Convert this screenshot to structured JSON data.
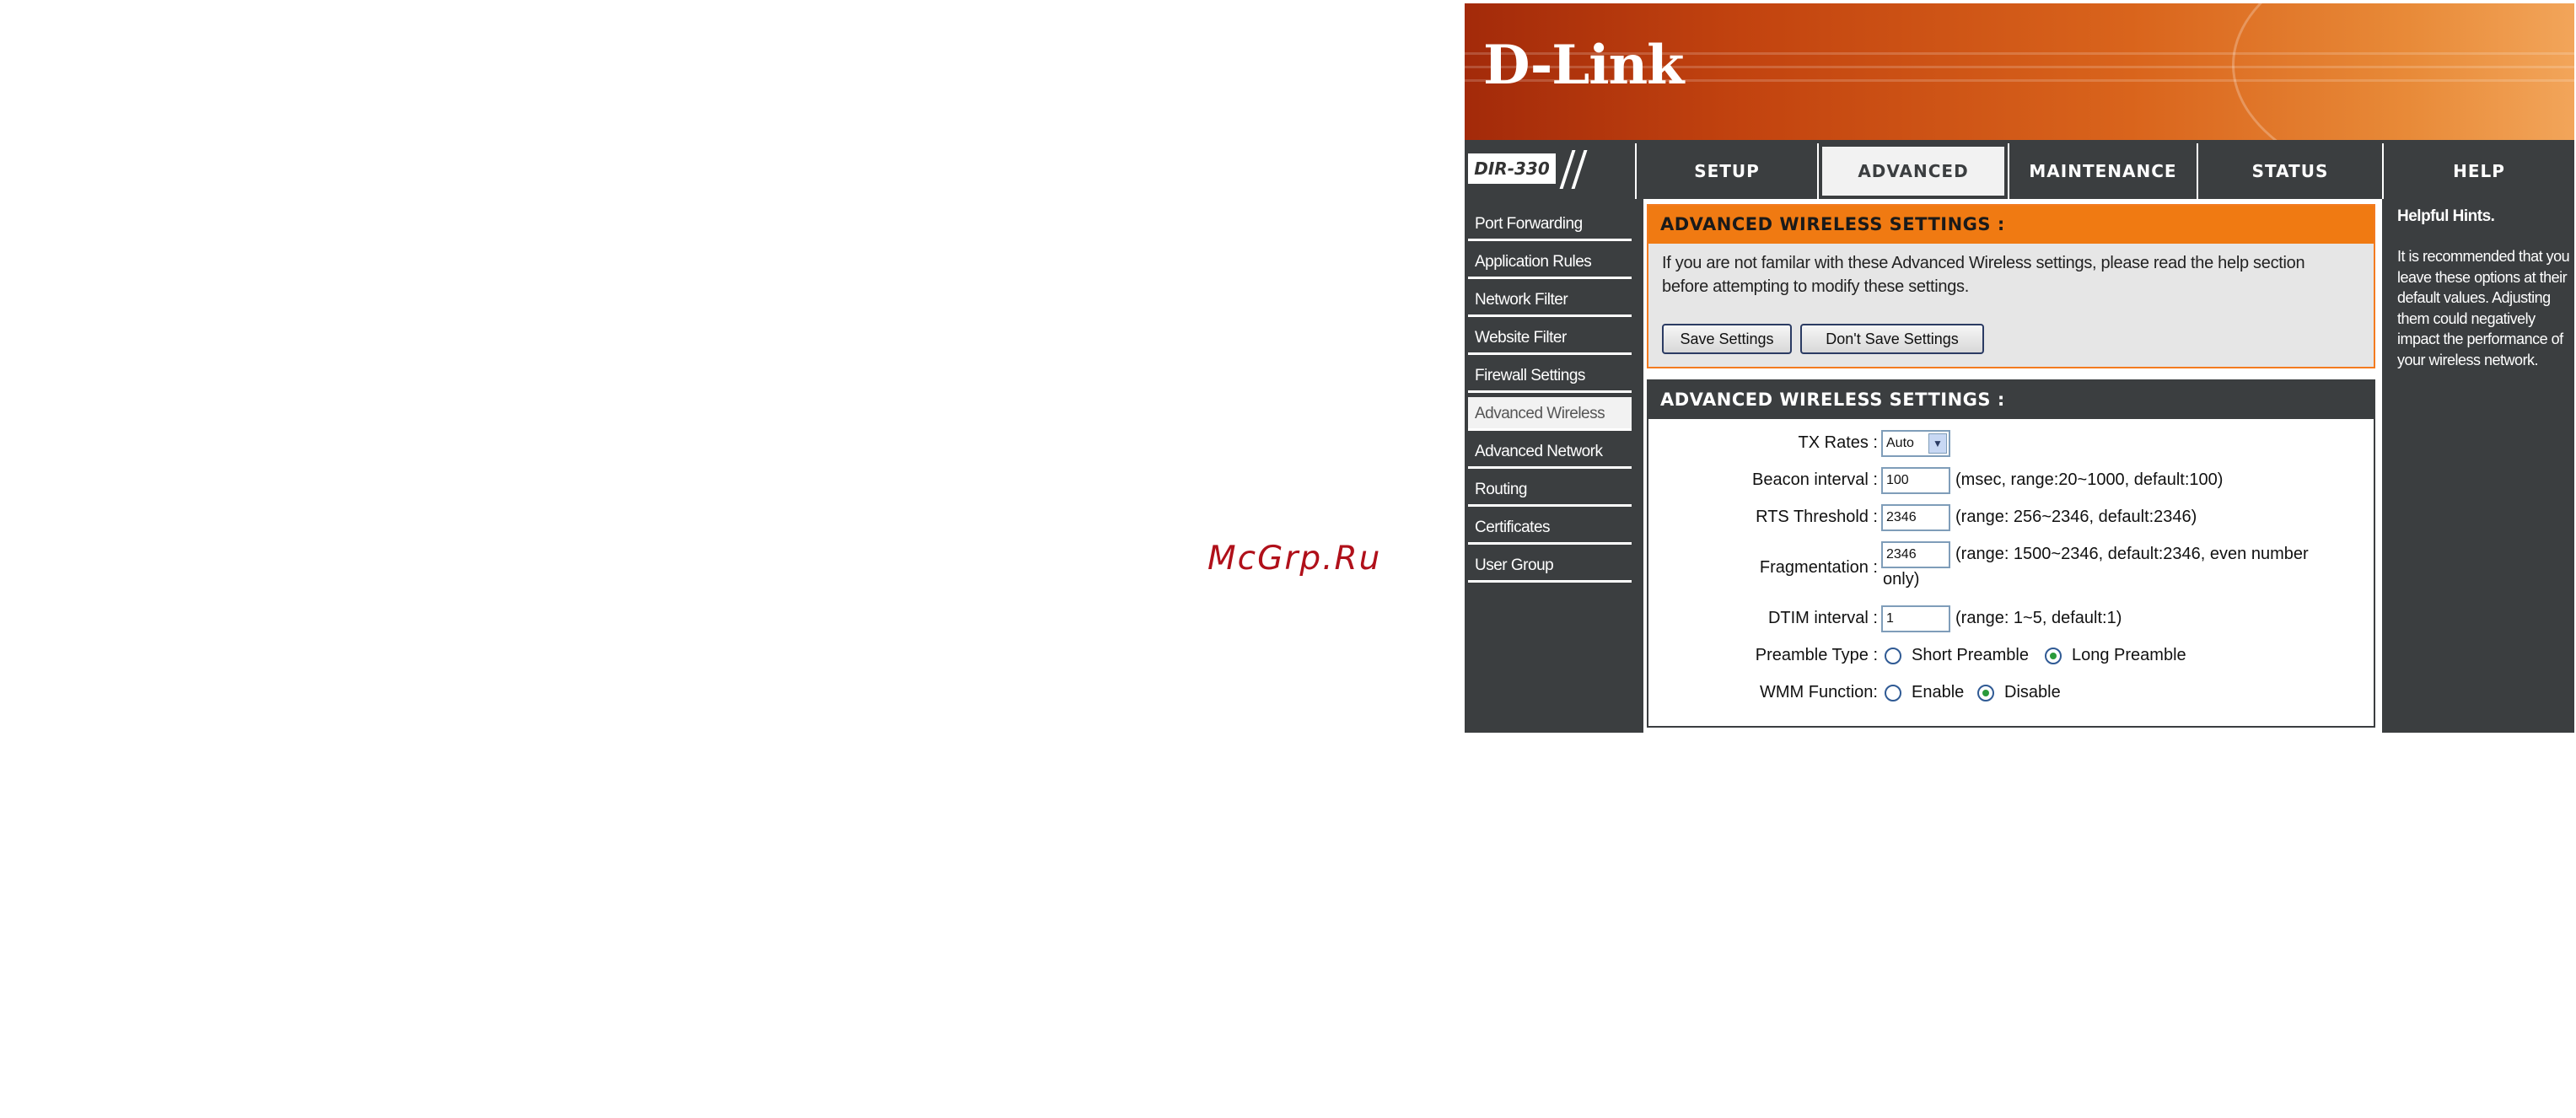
{
  "watermark": "McGrp.Ru",
  "brand": {
    "logo": "D-Link",
    "model": "DIR-330"
  },
  "tabs": [
    {
      "label": "SETUP"
    },
    {
      "label": "ADVANCED"
    },
    {
      "label": "MAINTENANCE"
    },
    {
      "label": "STATUS"
    },
    {
      "label": "HELP"
    }
  ],
  "active_tab": "ADVANCED",
  "sidebar": {
    "items": [
      {
        "label": "Port Forwarding"
      },
      {
        "label": "Application Rules"
      },
      {
        "label": "Network Filter"
      },
      {
        "label": "Website Filter"
      },
      {
        "label": "Firewall Settings"
      },
      {
        "label": "Advanced Wireless"
      },
      {
        "label": "Advanced Network"
      },
      {
        "label": "Routing"
      },
      {
        "label": "Certificates"
      },
      {
        "label": "User Group"
      }
    ],
    "active": "Advanced Wireless"
  },
  "intro": {
    "title": "ADVANCED WIRELESS SETTINGS :",
    "text_line1": "If you are not familar with these Advanced Wireless settings, please read the help section",
    "text_line2": "before attempting to modify these settings.",
    "save_label": "Save Settings",
    "dont_save_label": "Don't Save Settings"
  },
  "settings": {
    "title": "ADVANCED WIRELESS SETTINGS :",
    "tx_rates": {
      "label": "TX Rates :",
      "value": "Auto"
    },
    "beacon": {
      "label": "Beacon interval :",
      "value": "100",
      "note": "(msec, range:20~1000, default:100)"
    },
    "rts": {
      "label": "RTS Threshold :",
      "value": "2346",
      "note": "(range: 256~2346, default:2346)"
    },
    "fragmentation": {
      "label": "Fragmentation :",
      "value": "2346",
      "note_line1": "(range: 1500~2346, default:2346, even number",
      "note_line2": "only)"
    },
    "dtim": {
      "label": "DTIM interval :",
      "value": "1",
      "note": "(range: 1~5, default:1)"
    },
    "preamble": {
      "label": "Preamble Type :",
      "option_short": "Short Preamble",
      "option_long": "Long Preamble",
      "selected": "Long Preamble"
    },
    "wmm": {
      "label": "WMM Function:",
      "option_enable": "Enable",
      "option_disable": "Disable",
      "selected": "Disable"
    }
  },
  "help": {
    "title": "Helpful Hints.",
    "lines": [
      "It is recommended that you",
      "leave these options at their",
      "default values. Adjusting",
      "them could negatively",
      "impact the performance of",
      "your wireless network."
    ]
  },
  "colors": {
    "banner_orange": "#d9641c",
    "section_orange": "#f07a12",
    "dark_gray": "#3b3e40",
    "radio_selected": "#2a9a3a"
  }
}
